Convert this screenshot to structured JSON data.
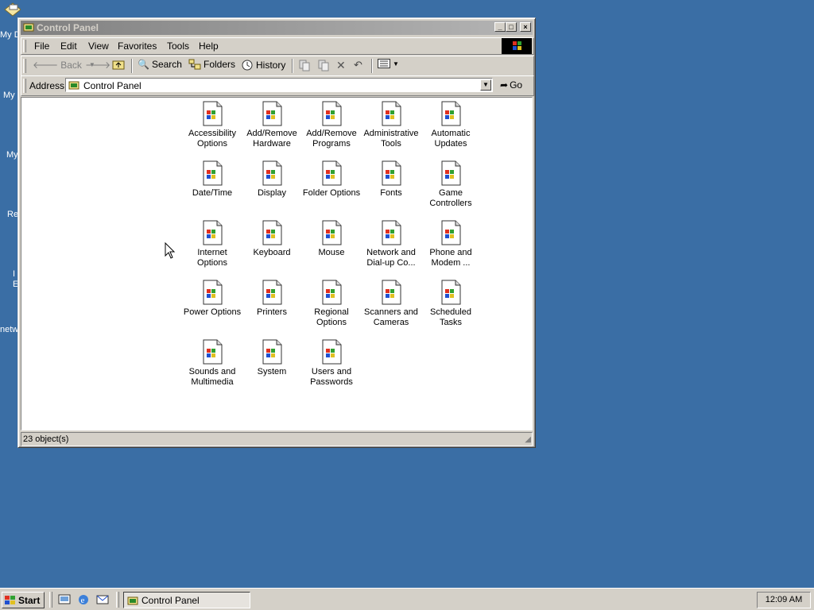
{
  "desktop": {
    "labels": [
      "My D",
      "My",
      "My",
      "Re",
      "I",
      "E",
      "netw"
    ]
  },
  "window": {
    "title": "Control Panel",
    "minimize_glyph": "_",
    "maximize_glyph": "□",
    "close_glyph": "×"
  },
  "menu": [
    "File",
    "Edit",
    "View",
    "Favorites",
    "Tools",
    "Help"
  ],
  "toolbar": {
    "back": "Back",
    "search": "Search",
    "folders": "Folders",
    "history": "History"
  },
  "address": {
    "label": "Address",
    "value": "Control Panel",
    "go": "Go"
  },
  "items": [
    {
      "label": "Accessibility Options"
    },
    {
      "label": "Add/Remove Hardware"
    },
    {
      "label": "Add/Remove Programs"
    },
    {
      "label": "Administrative Tools"
    },
    {
      "label": "Automatic Updates"
    },
    {
      "label": "Date/Time"
    },
    {
      "label": "Display"
    },
    {
      "label": "Folder Options"
    },
    {
      "label": "Fonts"
    },
    {
      "label": "Game Controllers"
    },
    {
      "label": "Internet Options"
    },
    {
      "label": "Keyboard"
    },
    {
      "label": "Mouse"
    },
    {
      "label": "Network and Dial-up Co..."
    },
    {
      "label": "Phone and Modem ..."
    },
    {
      "label": "Power Options"
    },
    {
      "label": "Printers"
    },
    {
      "label": "Regional Options"
    },
    {
      "label": "Scanners and Cameras"
    },
    {
      "label": "Scheduled Tasks"
    },
    {
      "label": "Sounds and Multimedia"
    },
    {
      "label": "System"
    },
    {
      "label": "Users and Passwords"
    }
  ],
  "status": {
    "text": "23 object(s)"
  },
  "taskbar": {
    "start": "Start",
    "task": "Control Panel",
    "clock": "12:09 AM"
  }
}
